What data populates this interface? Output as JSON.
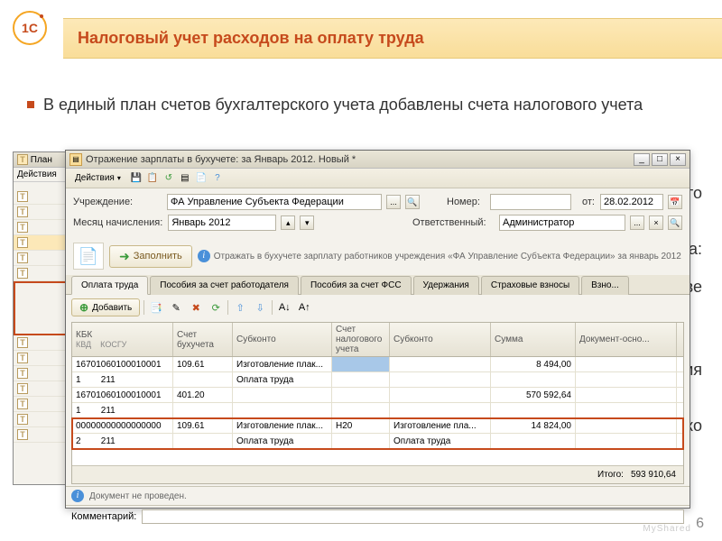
{
  "slide": {
    "title": "Налоговый учет расходов на оплату труда",
    "bullet1": "В единый план счетов бухгалтерского учета добавлены счета налогового учета",
    "frag1": "бконто",
    "frag2": "та:",
    "frag3": "нове",
    "frag4": "ния",
    "frag5": "олько",
    "page": "6",
    "watermark": "MyShared"
  },
  "backwin": {
    "title": "План",
    "menu": "Действия"
  },
  "win": {
    "title": "Отражение зарплаты в бухучете: за Январь 2012. Новый *",
    "actions": "Действия",
    "controls": {
      "min": "_",
      "max": "□",
      "close": "×"
    }
  },
  "form": {
    "org_label": "Учреждение:",
    "org_value": "ФА Управление Субъекта Федерации",
    "num_label": "Номер:",
    "num_value": "",
    "from_label": "от:",
    "from_value": "28.02.2012",
    "month_label": "Месяц начисления:",
    "month_value": "Январь 2012",
    "resp_label": "Ответственный:",
    "resp_value": "Администратор"
  },
  "fill": {
    "button": "Заполнить",
    "info": "Отражать в бухучете зарплату работников учреждения «ФА Управление Субъекта Федерации» за январь 2012"
  },
  "tabs": {
    "t1": "Оплата труда",
    "t2": "Пособия за счет работодателя",
    "t3": "Пособия за счет ФСС",
    "t4": "Удержания",
    "t5": "Страховые взносы",
    "t6": "Взно..."
  },
  "tabtool": {
    "add": "Добавить"
  },
  "grid": {
    "h_kbk": "КБК",
    "h_kvd": "КВД",
    "h_kosgu": "КОСГУ",
    "h_sch": "Счет бухучета",
    "h_sub1": "Субконто",
    "h_schn": "Счет налогового учета",
    "h_sub2": "Субконто",
    "h_sum": "Сумма",
    "h_doc": "Документ-осно...",
    "rows": [
      {
        "kbk": "16701060100010001",
        "kvd": "1",
        "kosgu": "211",
        "sch": "109.61",
        "sub1a": "Изготовление плак...",
        "sub1b": "Оплата труда",
        "schn": "",
        "sub2a": "",
        "sub2b": "",
        "sum": "8 494,00",
        "doc": ""
      },
      {
        "kbk": "16701060100010001",
        "kvd": "1",
        "kosgu": "211",
        "sch": "401.20",
        "sub1a": "",
        "sub1b": "",
        "schn": "",
        "sub2a": "",
        "sub2b": "",
        "sum": "570 592,64",
        "doc": ""
      },
      {
        "kbk": "00000000000000000",
        "kvd": "2",
        "kosgu": "211",
        "sch": "109.61",
        "sub1a": "Изготовление плак...",
        "sub1b": "Оплата труда",
        "schn": "Н20",
        "sub2a": "Изготовление пла...",
        "sub2b": "Оплата труда",
        "sum": "14 824,00",
        "doc": ""
      }
    ],
    "total_label": "Итого:",
    "total_value": "593 910,64"
  },
  "status": {
    "text": "Документ не проведен."
  },
  "comment": {
    "label": "Комментарий:"
  }
}
